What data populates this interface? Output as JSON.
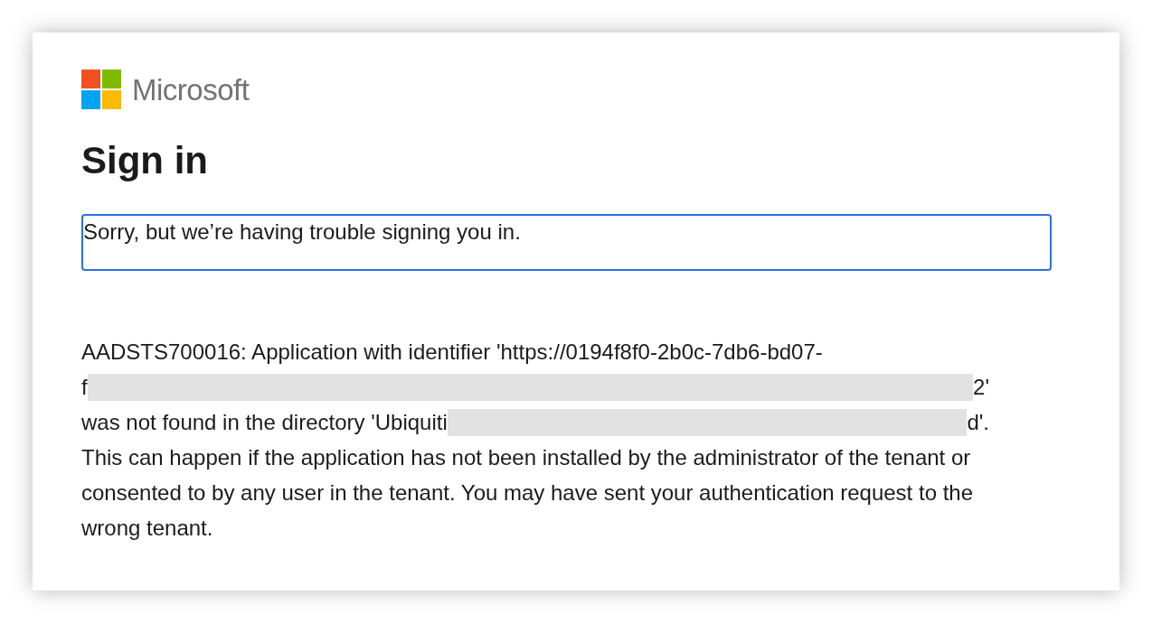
{
  "brand": {
    "name": "Microsoft"
  },
  "heading": "Sign in",
  "alert": "Sorry, but we’re having trouble signing you in.",
  "message": {
    "lines": [
      {
        "segments": [
          {
            "kind": "text",
            "text": "AADSTS700016: Application with identifier 'https://0194f8f0-2b0c-7db6-bd07-"
          }
        ]
      },
      {
        "segments": [
          {
            "kind": "text",
            "text": "f"
          },
          {
            "kind": "redaction"
          },
          {
            "kind": "text",
            "text": "2'"
          }
        ]
      },
      {
        "segments": [
          {
            "kind": "text",
            "text": "was not found in the directory 'Ubiquiti"
          },
          {
            "kind": "redaction"
          },
          {
            "kind": "text",
            "text": "d'."
          }
        ]
      }
    ],
    "paragraph": "This can happen if the application has not been installed by the administrator of the tenant or consented to by any user in the tenant. You may have sent your authentication request to the wrong tenant."
  }
}
